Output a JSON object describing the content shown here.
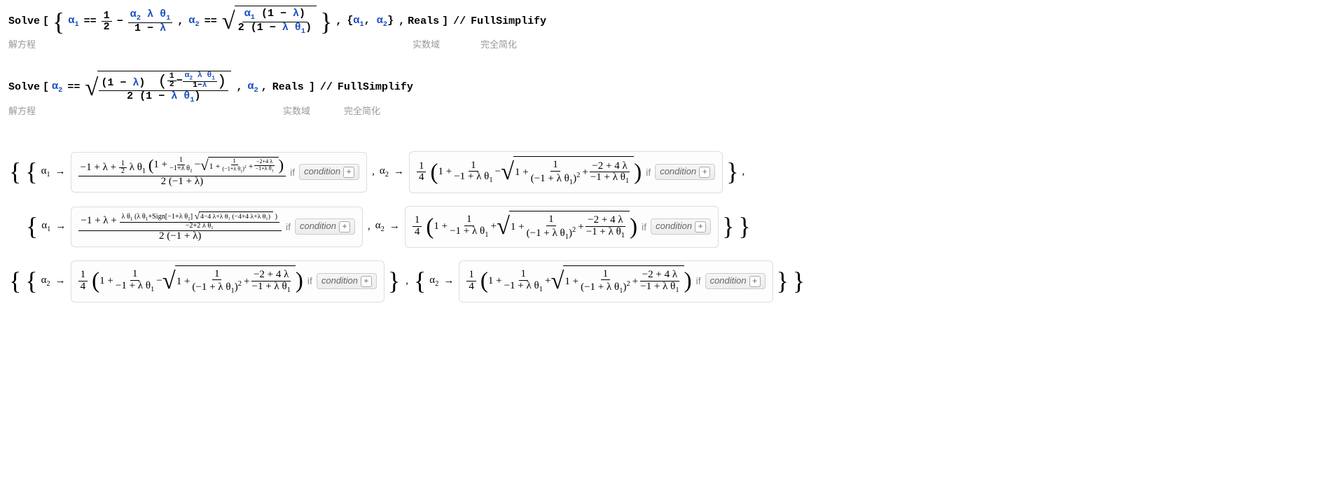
{
  "input1": {
    "solve": "Solve",
    "solve_hint": "解方程",
    "alpha1": "α",
    "alpha2": "α",
    "lambda": "λ",
    "theta": "θ",
    "half_num": "1",
    "half_den": "2",
    "eq": "==",
    "vars_open": "{",
    "vars_close": "}",
    "a1_label": "α₁",
    "a2_label": "α₂",
    "reals": "Reals",
    "reals_hint": "实数域",
    "fullsimp": "FullSimplify",
    "fullsimp_hint": "完全简化",
    "slashslash": "//"
  },
  "input2": {
    "solve": "Solve",
    "solve_hint": "解方程",
    "a2": "α₂",
    "eq": "==",
    "reals": "Reals",
    "reals_hint": "实数域",
    "fullsimp": "FullSimplify",
    "fullsimp_hint": "完全简化",
    "slashslash": "//"
  },
  "labels": {
    "if": "if",
    "condition": "condition",
    "arrow": "→",
    "one": "1",
    "two": "2",
    "four": "4",
    "minus": "−",
    "plus": "+",
    "neg1": "−1",
    "lambda": "λ",
    "theta1": "θ₁",
    "alpha1": "α₁",
    "alpha2": "α₂",
    "neg2p4l": "−2 + 4 λ",
    "sign": "Sign",
    "expr_4m4l": "4−4 λ+λ θ₁ (−4+4 λ+λ θ₁)",
    "neg2p2lt1": "−2+2 λ θ₁",
    "denom_2m1l": "2 (−1 + λ)"
  }
}
